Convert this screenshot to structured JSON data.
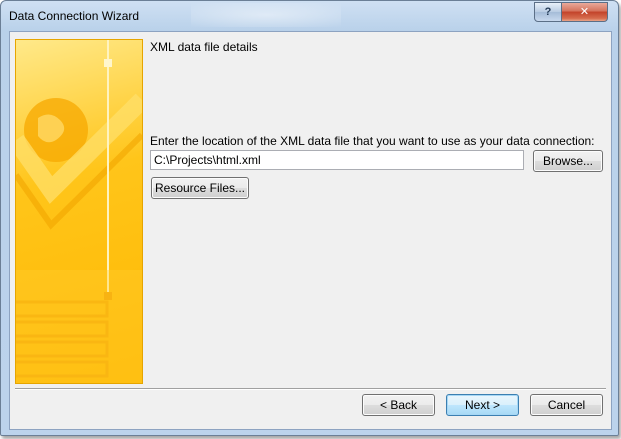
{
  "window": {
    "title": "Data Connection Wizard",
    "help_label": "?",
    "close_label": "✕"
  },
  "content": {
    "section_title": "XML data file details",
    "prompt": "Enter the location of the XML data file that you want to use as your data connection:",
    "path_value": "C:\\Projects\\html.xml",
    "browse_label": "Browse...",
    "resource_files_label": "Resource Files..."
  },
  "footer": {
    "back_label": "< Back",
    "next_label": "Next >",
    "cancel_label": "Cancel"
  },
  "colors": {
    "banner_yellow": "#ffc51a",
    "title_bar": "#bcd3ec",
    "close_red": "#c3432a"
  },
  "icons": [
    "globe-graphic",
    "checkmark-graphic",
    "form-graphic"
  ]
}
